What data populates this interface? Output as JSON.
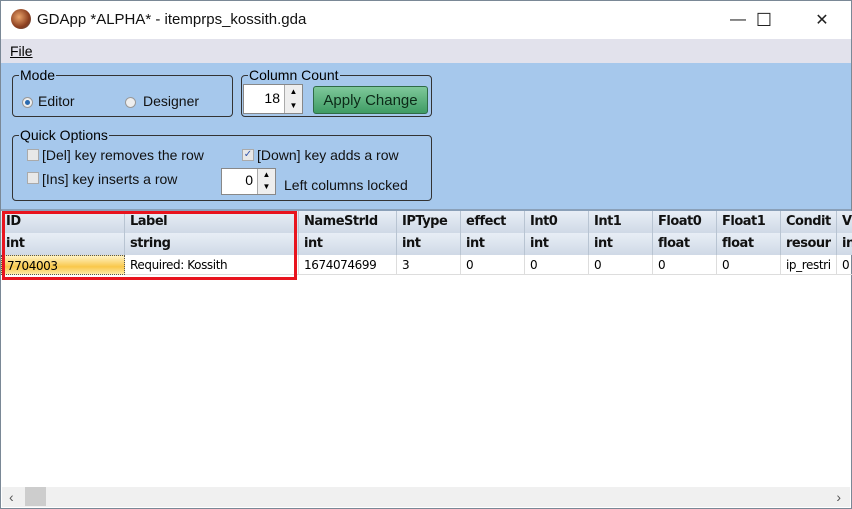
{
  "window": {
    "title": "GDApp *ALPHA*  -  itemprps_kossith.gda",
    "minimize": "—",
    "maximize": "☐",
    "close": "✕"
  },
  "menu": {
    "file": "File"
  },
  "mode": {
    "legend": "Mode",
    "editor": "Editor",
    "designer": "Designer",
    "selected": "Editor"
  },
  "column_count": {
    "legend": "Column Count",
    "value": "18",
    "apply": "Apply Change"
  },
  "quick_options": {
    "legend": "Quick Options",
    "del_removes": "[Del] key removes the row",
    "del_checked": false,
    "down_adds": "[Down] key adds a row",
    "down_checked": true,
    "ins_inserts": "[Ins] key inserts a row",
    "ins_checked": false,
    "locked_value": "0",
    "locked_label": "Left columns locked"
  },
  "grid": {
    "columns": [
      {
        "name": "ID",
        "type": "int"
      },
      {
        "name": "Label",
        "type": "string"
      },
      {
        "name": "NameStrId",
        "type": "int"
      },
      {
        "name": "IPType",
        "type": "int"
      },
      {
        "name": "effect",
        "type": "int"
      },
      {
        "name": "Int0",
        "type": "int"
      },
      {
        "name": "Int1",
        "type": "int"
      },
      {
        "name": "Float0",
        "type": "float"
      },
      {
        "name": "Float1",
        "type": "float"
      },
      {
        "name": "Condit",
        "type": "resour"
      },
      {
        "name": "V",
        "type": "in"
      }
    ],
    "rows": [
      [
        "7704003",
        "Required: Kossith",
        "1674074699",
        "3",
        "0",
        "0",
        "0",
        "0",
        "0",
        "ip_restri",
        "0"
      ]
    ]
  },
  "colors": {
    "panel": "#a6c8ec",
    "apply": "#4fa872",
    "highlight": "#e8141e"
  }
}
